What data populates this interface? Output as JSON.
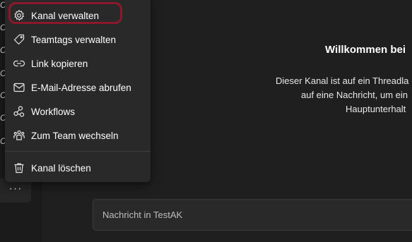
{
  "left_fragments": [
    "CE",
    "CE",
    "CE",
    "CE",
    "CE",
    "CE",
    "C"
  ],
  "more_button": "···",
  "menu": {
    "items": [
      {
        "label": "Kanal verwalten",
        "icon": "gear-icon"
      },
      {
        "label": "Teamtags verwalten",
        "icon": "tag-icon"
      },
      {
        "label": "Link kopieren",
        "icon": "link-icon"
      },
      {
        "label": "E-Mail-Adresse abrufen",
        "icon": "mail-icon"
      },
      {
        "label": "Workflows",
        "icon": "workflows-icon"
      },
      {
        "label": "Zum Team wechseln",
        "icon": "team-icon"
      },
      {
        "label": "Kanal löschen",
        "icon": "trash-icon"
      }
    ],
    "highlighted_item": "Kanal verwalten"
  },
  "welcome": {
    "title": "Willkommen bei",
    "lines": [
      "Dieser Kanal ist auf ein Threadla",
      "auf eine Nachricht, um ein",
      "Hauptunterhalt"
    ]
  },
  "compose": {
    "placeholder": "Nachricht in TestAK"
  },
  "colors": {
    "background": "#1f1f1f",
    "menu_bg": "#292929",
    "highlight": "#8a1a2b"
  }
}
